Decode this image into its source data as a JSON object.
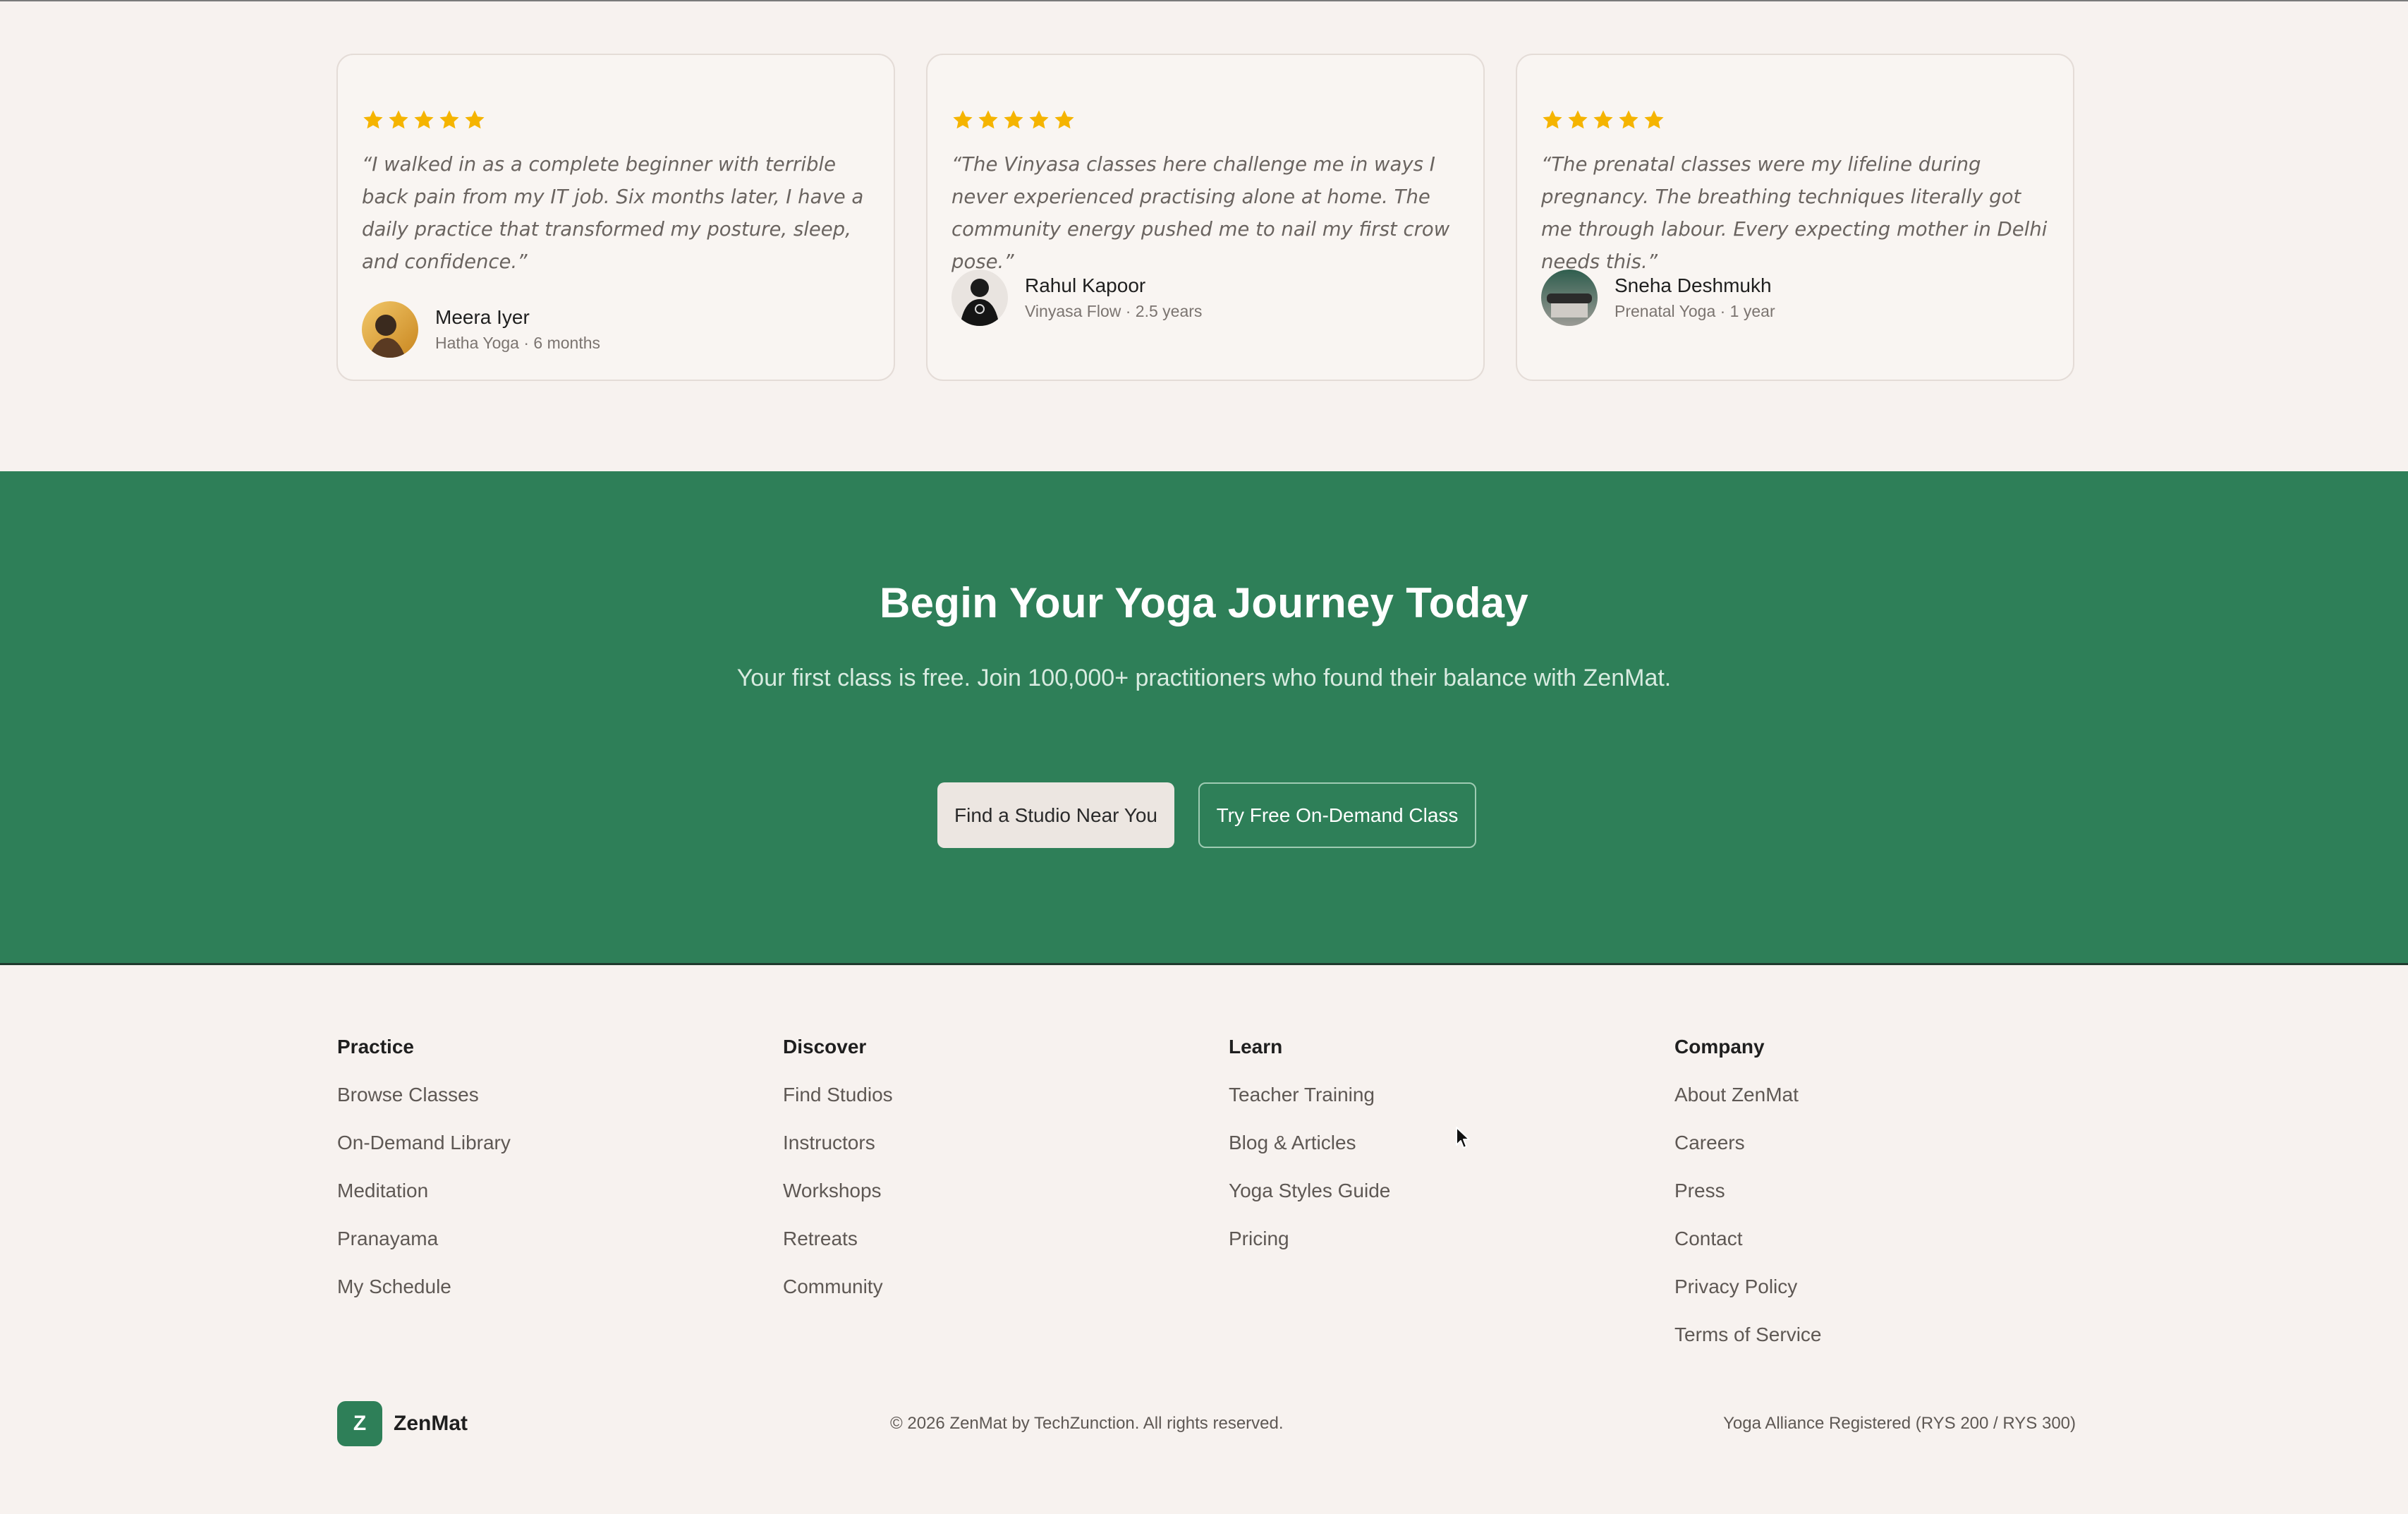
{
  "testimonials": [
    {
      "rating": 5,
      "quote": "“I walked in as a complete beginner with terrible back pain from my IT job. Six months later, I have a daily practice that transformed my posture, sleep, and confidence.”",
      "name": "Meera Iyer",
      "meta": "Hatha Yoga · 6 months"
    },
    {
      "rating": 5,
      "quote": "“The Vinyasa classes here challenge me in ways I never experienced practising alone at home. The community energy pushed me to nail my first crow pose.”",
      "name": "Rahul Kapoor",
      "meta": "Vinyasa Flow · 2.5 years"
    },
    {
      "rating": 5,
      "quote": "“The prenatal classes were my lifeline during pregnancy. The breathing techniques literally got me through labour. Every expecting mother in Delhi needs this.”",
      "name": "Sneha Deshmukh",
      "meta": "Prenatal Yoga · 1 year"
    }
  ],
  "cta": {
    "title": "Begin Your Yoga Journey Today",
    "subtitle": "Your first class is free. Join 100,000+ practitioners who found their balance with ZenMat.",
    "primary_label": "Find a Studio Near You",
    "secondary_label": "Try Free On-Demand Class"
  },
  "footer": {
    "columns": [
      {
        "heading": "Practice",
        "links": [
          "Browse Classes",
          "On-Demand Library",
          "Meditation",
          "Pranayama",
          "My Schedule"
        ]
      },
      {
        "heading": "Discover",
        "links": [
          "Find Studios",
          "Instructors",
          "Workshops",
          "Retreats",
          "Community"
        ]
      },
      {
        "heading": "Learn",
        "links": [
          "Teacher Training",
          "Blog & Articles",
          "Yoga Styles Guide",
          "Pricing"
        ]
      },
      {
        "heading": "Company",
        "links": [
          "About ZenMat",
          "Careers",
          "Press",
          "Contact",
          "Privacy Policy",
          "Terms of Service"
        ]
      }
    ],
    "brand_initial": "Z",
    "brand_name": "ZenMat",
    "copyright": "© 2026 ZenMat by TechZunction. All rights reserved.",
    "registered": "Yoga Alliance Registered (RYS 200 / RYS 300)"
  },
  "colors": {
    "accent_green": "#2e7f58",
    "star_gold": "#f5b400",
    "page_bg": "#f7f2ef"
  },
  "icons": [
    "star-icon",
    "avatar-photo",
    "cursor-pointer-icon"
  ]
}
